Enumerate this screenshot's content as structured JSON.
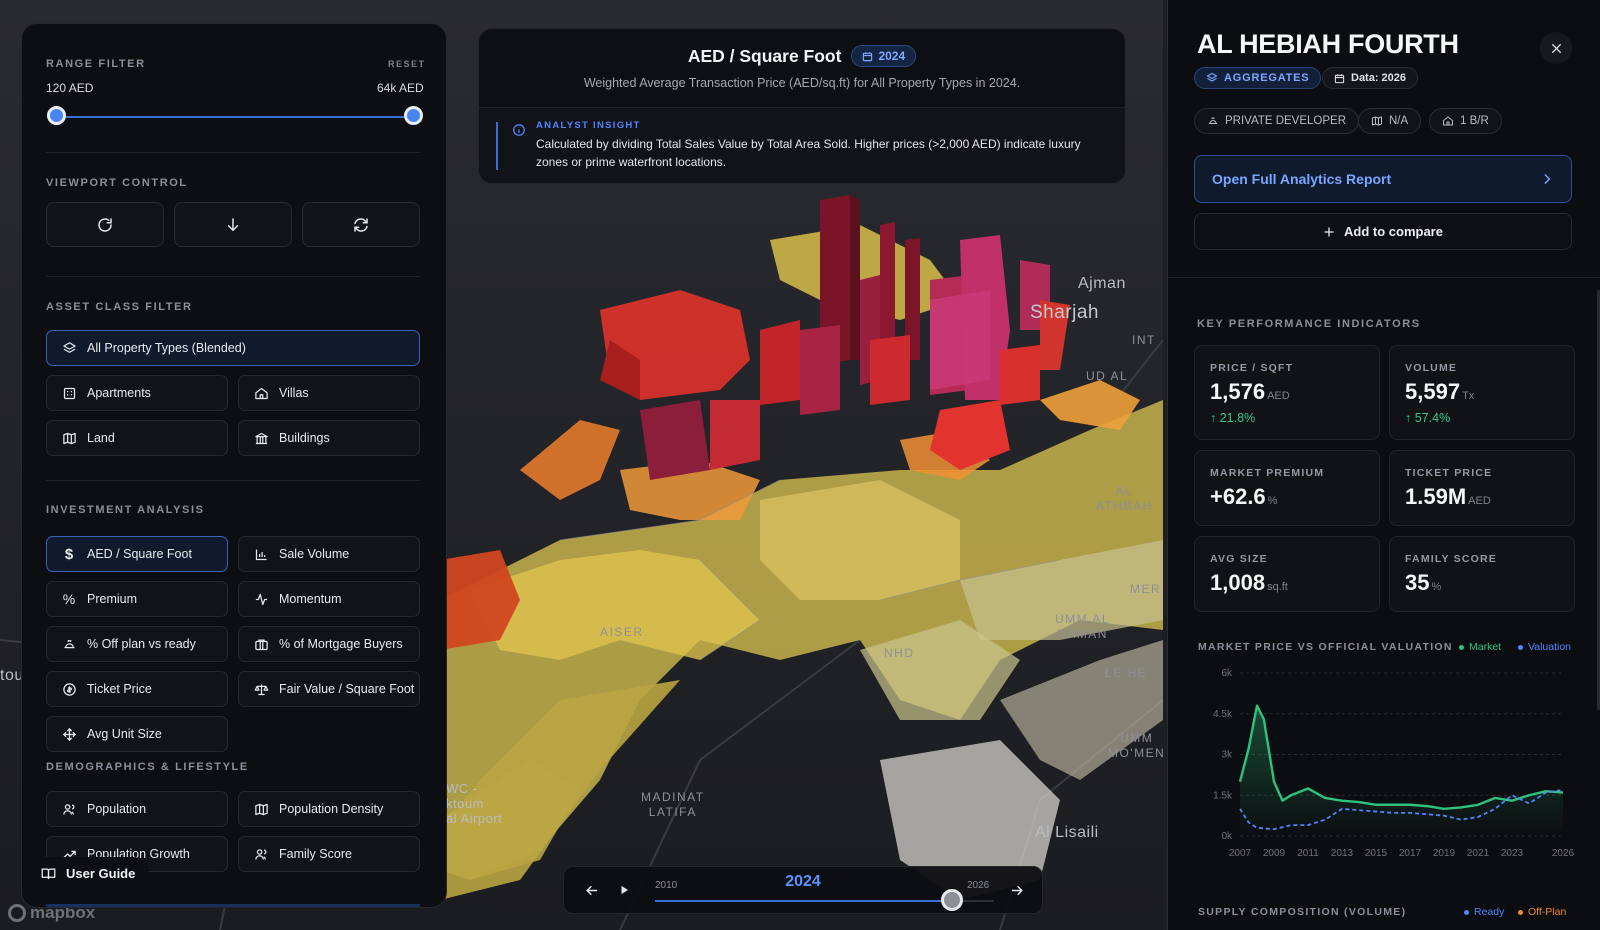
{
  "map": {
    "labels": {
      "ajman": "Ajman",
      "sharjah": "Sharjah",
      "al_athbah": "AL ATHBAH",
      "umm_al_daman": "UMM AL\nDAMAN",
      "le_he": "LE HE",
      "umm_mo_men": "UMM\nMO'MEN",
      "madinat_latifa": "MADINAT\nLATIFA",
      "nhd": "NHD",
      "aiser": "AISER",
      "int": "INT",
      "ud_al": "UD AL",
      "mer": "MER",
      "al_lisaili": "Al Lisaili",
      "airport": "WC -\nktoum\nal Airport",
      "tou": "tou"
    },
    "logo": "mapbox",
    "colors": {
      "high": "#e53935",
      "mid": "#f4a237",
      "low": "#d9c95a",
      "premium": "#b0295c"
    }
  },
  "left_panel": {
    "range_filter": {
      "label": "RANGE FILTER",
      "reset": "RESET",
      "min_label": "120 AED",
      "max_label": "64k AED",
      "min_pct": 0,
      "max_pct": 100
    },
    "viewport": {
      "label": "VIEWPORT CONTROL",
      "buttons": [
        {
          "icon": "rotate-cw-icon"
        },
        {
          "icon": "arrow-down-icon"
        },
        {
          "icon": "refresh-icon"
        }
      ]
    },
    "asset_class": {
      "label": "ASSET CLASS FILTER",
      "all": "All Property Types (Blended)",
      "items": [
        "Apartments",
        "Villas",
        "Land",
        "Buildings"
      ]
    },
    "investment": {
      "label": "INVESTMENT ANALYSIS",
      "items": [
        "AED / Square Foot",
        "Sale Volume",
        "Premium",
        "Momentum",
        "% Off plan vs ready",
        "% of Mortgage Buyers",
        "Ticket Price",
        "Fair Value / Square Foot",
        "Avg Unit Size"
      ]
    },
    "demographics": {
      "label": "DEMOGRAPHICS & LIFESTYLE",
      "items": [
        "Population",
        "Population Density",
        "Population Growth",
        "Family Score"
      ]
    },
    "user_guide": "User Guide"
  },
  "info_card": {
    "title": "AED / Square Foot",
    "year": "2024",
    "subtitle": "Weighted Average Transaction Price (AED/sq.ft) for All Property Types in 2024.",
    "insight_label": "ANALYST INSIGHT",
    "insight_text": "Calculated by dividing Total Sales Value by Total Area Sold. Higher prices (>2,000 AED) indicate luxury zones or prime waterfront locations."
  },
  "timeline": {
    "start": "2010",
    "end": "2026",
    "current": "2024",
    "start_year": 2010,
    "end_year": 2026,
    "current_year": 2024
  },
  "right_panel": {
    "title": "AL HEBIAH FOURTH",
    "aggregates": "AGGREGATES",
    "data_year": "Data: 2026",
    "tags": [
      "PRIVATE DEVELOPER",
      "N/A",
      "1 B/R"
    ],
    "report_button": "Open Full Analytics Report",
    "compare_button": "Add to compare",
    "kpi_label": "KEY PERFORMANCE INDICATORS",
    "kpis": [
      {
        "label": "PRICE / SQFT",
        "value": "1,576",
        "unit": "AED",
        "delta": "21.8%"
      },
      {
        "label": "VOLUME",
        "value": "5,597",
        "unit": "Tx",
        "delta": "57.4%"
      },
      {
        "label": "MARKET PREMIUM",
        "value": "+62.6",
        "unit": "%",
        "delta": ""
      },
      {
        "label": "TICKET PRICE",
        "value": "1.59M",
        "unit": "AED",
        "delta": ""
      },
      {
        "label": "AVG SIZE",
        "value": "1,008",
        "unit": "sq.ft",
        "delta": ""
      },
      {
        "label": "FAMILY SCORE",
        "value": "35",
        "unit": "%",
        "delta": ""
      }
    ],
    "chart_title": "MARKET PRICE VS OFFICIAL VALUATION",
    "supply_title": "SUPPLY COMPOSITION (VOLUME)",
    "supply_legend": [
      {
        "name": "Ready",
        "color": "#4d87ff"
      },
      {
        "name": "Off-Plan",
        "color": "#f08a2e"
      }
    ]
  },
  "chart_data": {
    "type": "line",
    "title": "MARKET PRICE VS OFFICIAL VALUATION",
    "legend_position": "top-right",
    "grid": true,
    "ylim": [
      0,
      6000
    ],
    "yticks": [
      0,
      1500,
      3000,
      4500,
      6000
    ],
    "ytick_labels": [
      "0k",
      "1.5k",
      "3k",
      "4.5k",
      "6k"
    ],
    "xlim": [
      2007,
      2026
    ],
    "xticks": [
      2007,
      2009,
      2011,
      2013,
      2015,
      2017,
      2019,
      2021,
      2023,
      2026
    ],
    "series": [
      {
        "name": "Market",
        "color": "#2ec27e",
        "x": [
          2007,
          2007.5,
          2008,
          2008.4,
          2009,
          2009.5,
          2010,
          2011,
          2012,
          2013,
          2014,
          2015,
          2016,
          2017,
          2018,
          2019,
          2020,
          2021,
          2022,
          2023,
          2024,
          2025,
          2026
        ],
        "y": [
          2000,
          3200,
          4800,
          4300,
          2000,
          1300,
          1500,
          1750,
          1400,
          1300,
          1250,
          1150,
          1150,
          1150,
          1100,
          1000,
          1050,
          1150,
          1400,
          1300,
          1500,
          1650,
          1600
        ]
      },
      {
        "name": "Valuation",
        "color": "#4d87ff",
        "x": [
          2007,
          2007.5,
          2008,
          2009,
          2010,
          2011,
          2012,
          2013,
          2014,
          2015,
          2016,
          2017,
          2018,
          2019,
          2020,
          2021,
          2022,
          2023,
          2024,
          2025,
          2026
        ],
        "y": [
          1000,
          500,
          300,
          250,
          400,
          400,
          600,
          1000,
          950,
          900,
          850,
          850,
          800,
          750,
          600,
          700,
          1000,
          1500,
          1200,
          1600,
          1700
        ]
      }
    ]
  }
}
